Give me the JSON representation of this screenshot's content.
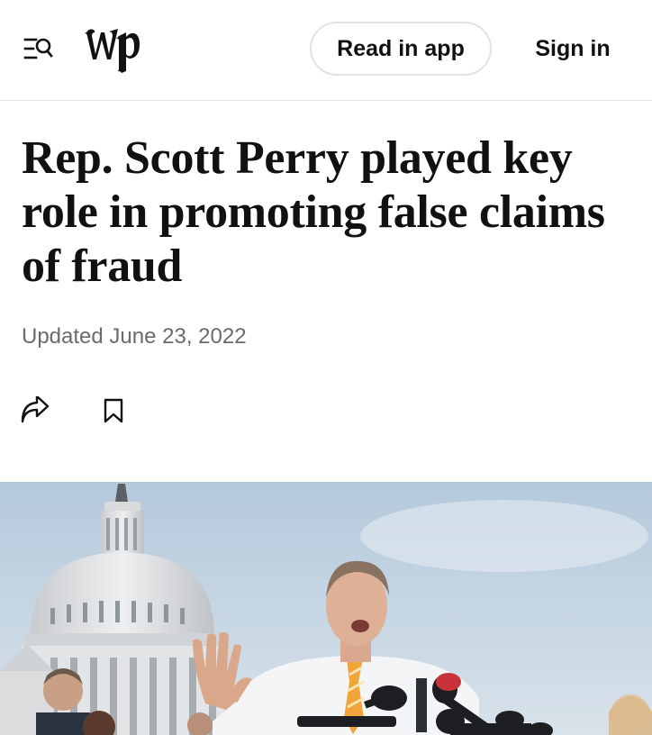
{
  "header": {
    "menu_search_icon": "menu-search-icon",
    "logo_icon": "wp-logo",
    "read_in_app_label": "Read in app",
    "sign_in_label": "Sign in"
  },
  "article": {
    "headline": "Rep. Scott Perry played key role in promoting false claims of fraud",
    "timestamp": "Updated June 23, 2022",
    "share_icon": "share-icon",
    "bookmark_icon": "bookmark-icon"
  },
  "photo": {
    "subject": "news-photo"
  },
  "colors": {
    "text": "#111111",
    "muted": "#6b6b6b",
    "border": "#e2e2e2",
    "background": "#ffffff"
  }
}
